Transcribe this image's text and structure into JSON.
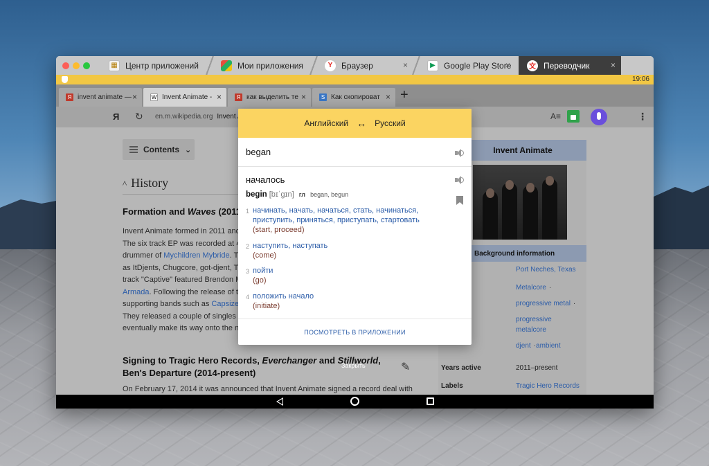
{
  "titlebar": {
    "tabs": [
      {
        "label": "Центр приложений",
        "icon": "app-center-icon",
        "active": false
      },
      {
        "label": "Мои приложения",
        "icon": "my-apps-icon",
        "active": false
      },
      {
        "label": "Браузер",
        "icon": "yandex-browser-icon",
        "active": false
      },
      {
        "label": "Google Play Store",
        "icon": "play-store-icon",
        "active": false
      },
      {
        "label": "Переводчик",
        "icon": "translator-icon",
        "active": true
      }
    ],
    "close_glyph": "×"
  },
  "status": {
    "time": "19:06"
  },
  "browser_tabs": [
    {
      "label": "invent animate —",
      "favicon": "Я",
      "favicon_color": "#c0392b"
    },
    {
      "label": "Invent Animate -",
      "favicon": "W",
      "favicon_color": "#ffffff"
    },
    {
      "label": "как выделить те",
      "favicon": "Я",
      "favicon_color": "#c0392b"
    },
    {
      "label": "Как скопироват",
      "favicon": "S",
      "favicon_color": "#3a76c4"
    }
  ],
  "address_bar": {
    "yandex_logo": "Я",
    "domain": "en.m.wikipedia.org",
    "page_title": "Invent A"
  },
  "page": {
    "contents_label": "Contents",
    "history_title": "History",
    "formation_heading_start": "Formation and ",
    "formation_heading_italic": "Waves",
    "formation_heading_end": " (2011–",
    "para_lines": [
      "Invent Animate formed in 2011 and",
      "The six track EP was recorded at 4",
      "drummer of ",
      "as ItDjents, Chugcore, got-djent, Th",
      "track \"Captive\" featured Brendon M",
      "Armada",
      "supporting bands such as ",
      "They released a couple of singles in",
      "eventually make its way onto the ne"
    ],
    "para_links": {
      "mychildren": "Mychildren Mybride",
      "mychildren_tail": ". Th",
      "armada_tail": ". Following the release of th",
      "capsize": "Capsize",
      "capsize_tail": ","
    },
    "signing_start": "Signing to Tragic Hero Records, ",
    "signing_italic1": "Everchanger",
    "signing_mid": " and ",
    "signing_italic2": "Stillworld",
    "signing_end": ", Ben's Departure (2014-present)",
    "close_hint": "Закрыть",
    "feb_text": "On February 17, 2014 it was announced that Invent Animate signed a record deal with"
  },
  "infobox": {
    "title": "Invent Animate",
    "bg_info": "Background information",
    "origin": "Port Neches, Texas",
    "genres": [
      "Metalcore",
      "progressive metal",
      "progressive",
      "metalcore",
      "djent",
      "ambient"
    ],
    "years_active_label": "Years active",
    "years_active": "2011–present",
    "labels_label": "Labels",
    "labels": "Tragic Hero Records"
  },
  "translator": {
    "source_lang": "Английский",
    "target_lang": "Русский",
    "swap_glyph": "↔",
    "query": "began",
    "main_translation": "началось",
    "headword": "begin",
    "transcription": "[bɪˈgɪn]",
    "pos": "гл",
    "forms": "began, begun",
    "senses": [
      {
        "num": "1",
        "syn_lines": [
          "начинать, начать, начаться, стать, начинаться,",
          "приступить, приняться, приступать, стартовать"
        ],
        "gloss": "(start, proceed)"
      },
      {
        "num": "2",
        "syn_lines": [
          "наступить, наступать"
        ],
        "gloss": "(come)"
      },
      {
        "num": "3",
        "syn_lines": [
          "пойти"
        ],
        "gloss": "(go)"
      },
      {
        "num": "4",
        "syn_lines": [
          "положить начало"
        ],
        "gloss": "(initiate)"
      }
    ],
    "open_in_app": "ПОСМОТРЕТЬ В ПРИЛОЖЕНИИ"
  },
  "colors": {
    "accent_yellow": "#fbd461",
    "link_blue": "#2b5ca8",
    "gloss_red": "#7a3b2e"
  }
}
